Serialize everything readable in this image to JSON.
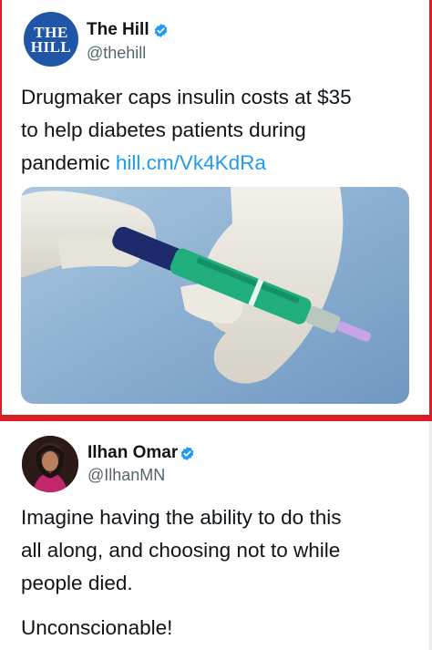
{
  "tweet1": {
    "avatar_text_line1": "THE",
    "avatar_text_line2": "HILL",
    "display_name": "The Hill",
    "handle": "@thehill",
    "text_line1": "Drugmaker caps insulin costs at $35",
    "text_line2": "to help diabetes patients during",
    "text_line3_prefix": "pandemic ",
    "link": "hill.cm/Vk4KdRa"
  },
  "tweet2": {
    "display_name": "Ilhan Omar",
    "handle": "@IlhanMN",
    "text_line1": "Imagine having the ability to do this",
    "text_line2": "all along, and choosing not to while",
    "text_line3": "people died.",
    "text_line4": "Unconscionable!"
  },
  "colors": {
    "accent_red": "#d81f26",
    "link_blue": "#1d9bf0",
    "verified_blue": "#1d9bf0",
    "hill_avatar_blue": "#1f56a8"
  },
  "icons": {
    "verified": "verified-badge-icon"
  }
}
